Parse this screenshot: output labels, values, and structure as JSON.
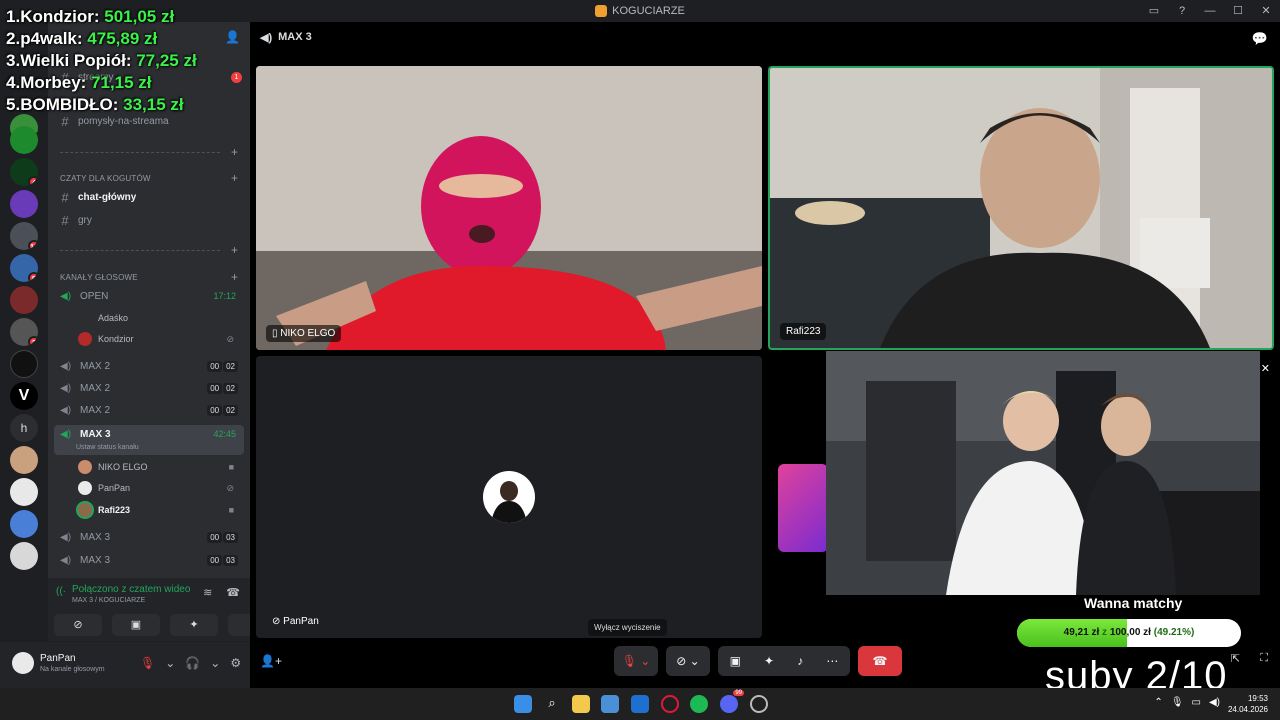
{
  "window": {
    "title": "KOGUCIARZE"
  },
  "leaderboard": [
    {
      "rank": "1.",
      "name": "Kondzior:",
      "amount": "501,05 zł"
    },
    {
      "rank": "2.",
      "name": "p4walk:",
      "amount": "475,89 zł"
    },
    {
      "rank": "3.",
      "name": "Wielki Popiół:",
      "amount": "77,25 zł"
    },
    {
      "rank": "4.",
      "name": "Morbey:",
      "amount": "71,15 zł"
    },
    {
      "rank": "5.",
      "name": "BOMBIDŁO:",
      "amount": "33,15 zł"
    }
  ],
  "sidebar": {
    "top_channel": "streamy",
    "top_badge": "1",
    "pomysly": "pomysły-na-streama",
    "category_chat": "CZATY DLA KOGUTÓW",
    "chat_glowny": "chat-główny",
    "gry": "gry",
    "category_voice": "KANAŁY GŁOSOWE",
    "open": {
      "name": "OPEN",
      "time": "17:12"
    },
    "adasko": "Adaśko",
    "kondzior": "Kondzior",
    "max2": [
      {
        "name": "MAX 2",
        "a": "00",
        "b": "02"
      },
      {
        "name": "MAX 2",
        "a": "00",
        "b": "02"
      },
      {
        "name": "MAX 2",
        "a": "00",
        "b": "02"
      }
    ],
    "max3_active": {
      "name": "MAX 3",
      "time": "42:45",
      "status": "Ustaw status kanału"
    },
    "members": [
      "NIKO ELGO",
      "PanPan",
      "Rafi223"
    ],
    "max3": [
      {
        "name": "MAX 3",
        "a": "00",
        "b": "03"
      },
      {
        "name": "MAX 3",
        "a": "00",
        "b": "03"
      }
    ]
  },
  "server_badges": [
    "1",
    "4",
    "10",
    "5",
    "2"
  ],
  "voice_panel": {
    "status": "Połączono z czatem wideo",
    "channel": "MAX 3 / KOGUCIARZE"
  },
  "user_panel": {
    "name": "PanPan",
    "status": "Na kanale głosowym"
  },
  "stage": {
    "channel": "MAX 3",
    "tiles": [
      "NIKO ELGO",
      "Rafi223",
      "PanPan"
    ],
    "tooltip": "Wyłącz wyciszenie"
  },
  "overlay": {
    "goal_title": "Wanna matchy",
    "goal_current": "49,21 zł",
    "goal_sep": "z",
    "goal_target": "100,00 zł",
    "goal_percent_label": "(49.21%)",
    "goal_fraction": 0.4921,
    "suby": "suby 2/10"
  },
  "taskbar": {
    "time": "19:53",
    "date": "24.04.2026",
    "discord_badge": "99"
  },
  "colors": {
    "accent_green": "#23a55a",
    "leader_green": "#3cf04a",
    "danger": "#da373c"
  }
}
